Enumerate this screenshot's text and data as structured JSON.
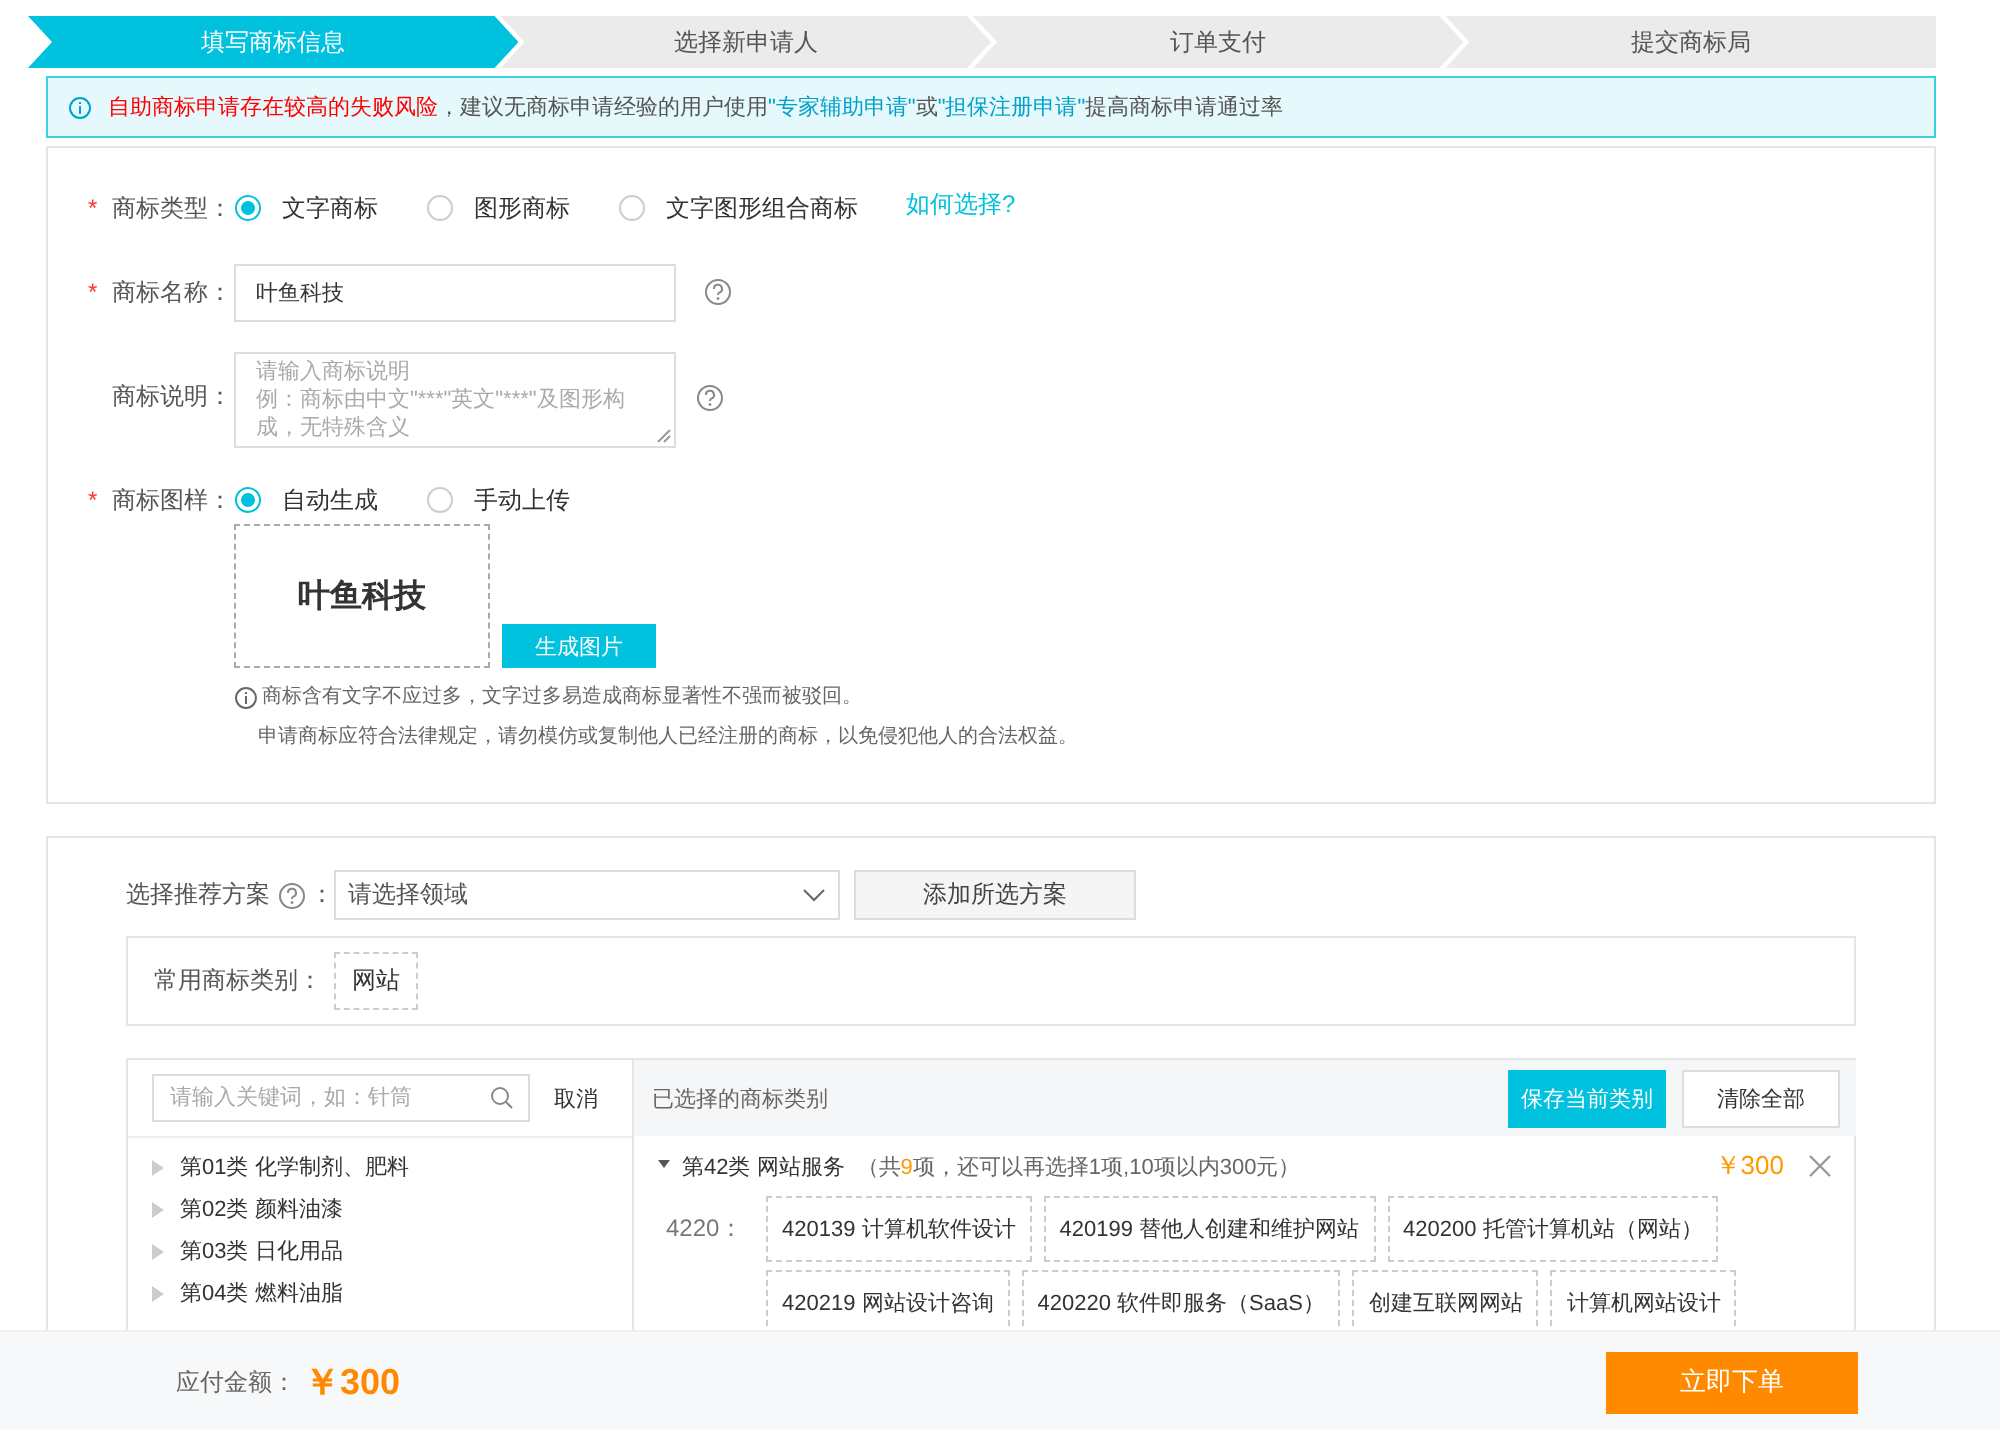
{
  "steps": [
    {
      "label": "填写商标信息",
      "selected": true
    },
    {
      "label": "选择新申请人",
      "selected": false
    },
    {
      "label": "订单支付",
      "selected": false
    },
    {
      "label": "提交商标局",
      "selected": false
    }
  ],
  "alert": [
    {
      "kind": "warning",
      "text": "自助商标申请存在较高的失败风险"
    },
    {
      "kind": "text",
      "text": "，建议无商标申请经验的用户使用"
    },
    {
      "kind": "link",
      "text": "\"专家辅助申请\""
    },
    {
      "kind": "text",
      "text": "或"
    },
    {
      "kind": "link",
      "text": "\"担保注册申请\""
    },
    {
      "kind": "text",
      "text": "提高商标申请通过率"
    }
  ],
  "form": {
    "type_field": {
      "required_mark": "*",
      "label": "商标类型：",
      "options": [
        {
          "label": "文字商标",
          "selected": true
        },
        {
          "label": "图形商标",
          "selected": false
        },
        {
          "label": "文字图形组合商标",
          "selected": false
        }
      ],
      "help_link": "如何选择?"
    },
    "name_field": {
      "required_mark": "*",
      "label": "商标名称：",
      "value": "叶鱼科技"
    },
    "description_field": {
      "label": "商标说明：",
      "placeholder_lines": [
        "请输入商标说明",
        "例：商标由中文\"***\"英文\"***\"及图形构成，无特殊含义"
      ]
    },
    "sample_field": {
      "required_mark": "*",
      "label": "商标图样：",
      "options": [
        {
          "label": "自动生成",
          "selected": true
        },
        {
          "label": "手动上传",
          "selected": false
        }
      ],
      "preview_text": "叶鱼科技",
      "generate_button": "生成图片",
      "notes": [
        "商标含有文字不应过多，文字过多易造成商标显著性不强而被驳回。",
        "申请商标应符合法律规定，请勿模仿或复制他人已经注册的商标，以免侵犯他人的合法权益。"
      ]
    }
  },
  "classes": {
    "plan": {
      "label": "选择推荐方案",
      "colon": "：",
      "select_placeholder": "请选择领域",
      "add_button": "添加所选方案"
    },
    "common": {
      "label": "常用商标类别：",
      "tags": [
        "网站"
      ]
    },
    "search": {
      "placeholder": "请输入关键词，如：针筒",
      "cancel": "取消"
    },
    "categories": [
      "第01类 化学制剂、肥料",
      "第02类 颜料油漆",
      "第03类 日化用品",
      "第04类 燃料油脂"
    ],
    "selected_panel": {
      "title": "已选择的商标类别",
      "save_button": "保存当前类别",
      "clear_button": "清除全部",
      "groups": [
        {
          "name": "第42类 网站服务",
          "summary_prefix": "（共",
          "count": "9",
          "summary_suffix": "项，还可以再选择1项,10项以内300元）",
          "price": "￥300",
          "expanded": true,
          "subgroups": [
            {
              "code": "4220：",
              "items": [
                "420139 计算机软件设计",
                "420199 替他人创建和维护网站",
                "420200 托管计算机站（网站）",
                "420219 网站设计咨询",
                "420220 软件即服务（SaaS）",
                "创建互联网网站",
                "计算机网站设计"
              ]
            }
          ]
        }
      ]
    }
  },
  "footer": {
    "label": "应付金额：",
    "amount": "￥300",
    "submit_button": "立即下单"
  }
}
